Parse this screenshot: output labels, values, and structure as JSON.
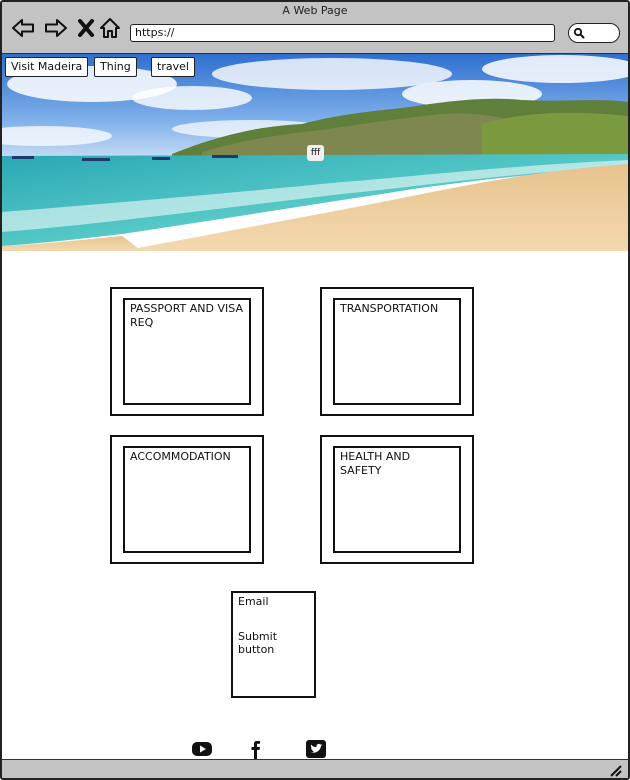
{
  "window": {
    "title": "A Web Page"
  },
  "browser": {
    "url": "https://",
    "icons": [
      "back-arrow-icon",
      "forward-arrow-icon",
      "close-x-icon",
      "home-icon",
      "search-icon"
    ]
  },
  "nav": {
    "tabs": [
      {
        "label": "Visit Madeira"
      },
      {
        "label": "Thing"
      },
      {
        "label": "travel"
      }
    ]
  },
  "hero": {
    "image": "beach-landscape",
    "caption": "fff"
  },
  "cards": [
    {
      "title": "PASSPORT AND VISA REQ"
    },
    {
      "title": "TRANSPORTATION"
    },
    {
      "title": "ACCOMMODATION"
    },
    {
      "title": "HEALTH AND SAFETY"
    }
  ],
  "form": {
    "email_label": "Email",
    "submit_label": "Submit button"
  },
  "social": [
    "youtube-icon",
    "facebook-icon",
    "twitter-icon"
  ]
}
